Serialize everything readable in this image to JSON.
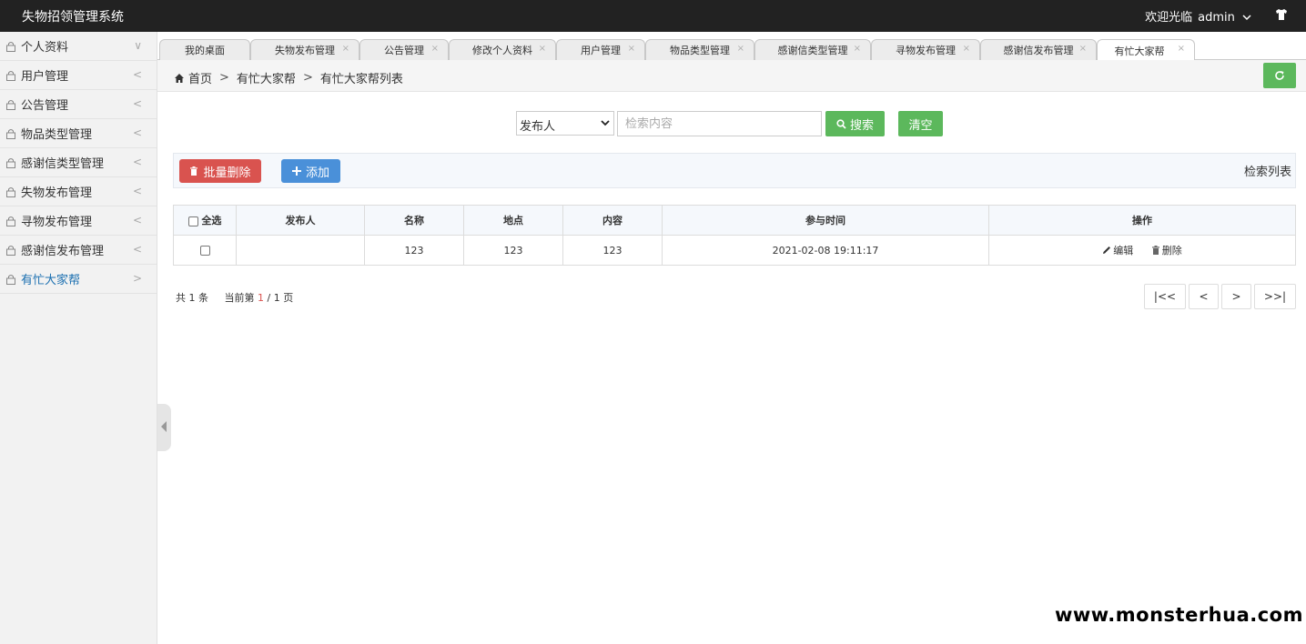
{
  "app": {
    "title": "失物招领管理系统",
    "welcome": "欢迎光临",
    "username": "admin"
  },
  "sidebar": {
    "items": [
      {
        "label": "个人资料",
        "arrow": "∨"
      },
      {
        "label": "用户管理",
        "arrow": "<"
      },
      {
        "label": "公告管理",
        "arrow": "<"
      },
      {
        "label": "物品类型管理",
        "arrow": "<"
      },
      {
        "label": "感谢信类型管理",
        "arrow": "<"
      },
      {
        "label": "失物发布管理",
        "arrow": "<"
      },
      {
        "label": "寻物发布管理",
        "arrow": "<"
      },
      {
        "label": "感谢信发布管理",
        "arrow": "<"
      },
      {
        "label": "有忙大家帮",
        "arrow": ">"
      }
    ],
    "active_index": 8
  },
  "tabs": [
    {
      "label": "我的桌面"
    },
    {
      "label": "失物发布管理"
    },
    {
      "label": "公告管理"
    },
    {
      "label": "修改个人资料"
    },
    {
      "label": "用户管理"
    },
    {
      "label": "物品类型管理"
    },
    {
      "label": "感谢信类型管理"
    },
    {
      "label": "寻物发布管理"
    },
    {
      "label": "感谢信发布管理"
    },
    {
      "label": "有忙大家帮"
    }
  ],
  "tab_close": "×",
  "breadcrumb": {
    "home": "首页",
    "sep": ">",
    "level1": "有忙大家帮",
    "level2": "有忙大家帮列表"
  },
  "search": {
    "field_selected": "发布人",
    "placeholder": "检索内容",
    "search_label": "搜索",
    "clear_label": "清空"
  },
  "toolbar": {
    "batch_delete": "批量删除",
    "add": "添加",
    "title": "检索列表"
  },
  "table": {
    "headers": {
      "select_all": "全选",
      "publisher": "发布人",
      "name": "名称",
      "location": "地点",
      "content": "内容",
      "time": "参与时间",
      "actions": "操作"
    },
    "rows": [
      {
        "publisher": "",
        "name": "123",
        "location": "123",
        "content": "123",
        "time": "2021-02-08 19:11:17"
      }
    ],
    "edit_label": "编辑",
    "delete_label": "删除"
  },
  "pagination": {
    "total_prefix": "共",
    "total": "1",
    "total_suffix": "条",
    "current_prefix": "当前第",
    "current": "1",
    "slash": "/",
    "pages": "1",
    "pages_suffix": "页",
    "first": "|<<",
    "prev": "<",
    "next": ">",
    "last": ">>|"
  },
  "watermark": "www.monsterhua.com",
  "colors": {
    "topbar": "#222222",
    "success": "#5cb85c",
    "danger": "#d9534f",
    "primary": "#4a90d9",
    "active_link": "#1a6fb0"
  },
  "icons": {
    "sidebar": "lock-icon",
    "home": "home-icon",
    "refresh": "refresh-icon",
    "search": "search-icon",
    "trash": "trash-icon",
    "plus": "plus-icon",
    "edit": "pencil-icon",
    "user_menu": "chevron-down-icon",
    "theme": "shirt-icon"
  }
}
